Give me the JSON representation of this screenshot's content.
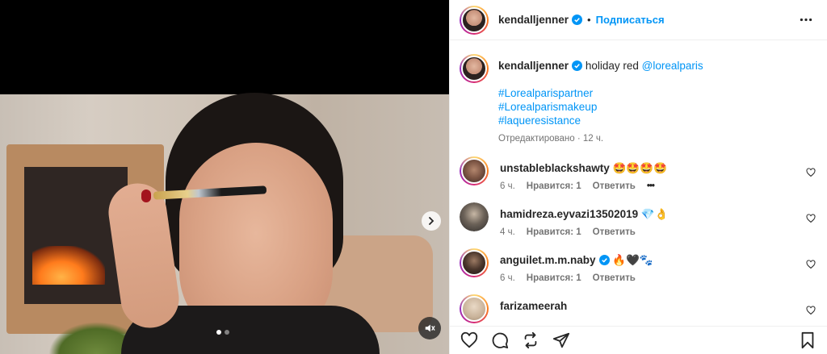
{
  "post": {
    "author": "kendalljenner",
    "separator": "•",
    "follow_label": "Подписаться",
    "caption_text": "holiday red",
    "caption_mention": "@lorealparis",
    "hashtags": [
      "#Lorealparispartner",
      "#Lorealparismakeup",
      "#laqueresistance"
    ],
    "edited_label": "Отредактировано",
    "time": "12 ч."
  },
  "media": {
    "carousel_count": 2,
    "active_index": 0
  },
  "comments": [
    {
      "username": "unstableblackshawty",
      "text": "🤩🤩🤩🤩",
      "time": "6 ч.",
      "likes": "Нравится: 1",
      "reply": "Ответить",
      "more": "•••"
    },
    {
      "username": "hamidreza.eyvazi13502019",
      "text": "💎👌",
      "time": "4 ч.",
      "likes": "Нравится: 1",
      "reply": "Ответить"
    },
    {
      "username": "anguilet.m.m.naby",
      "text": "🔥🖤🐾",
      "time": "6 ч.",
      "likes": "Нравится: 1",
      "reply": "Ответить",
      "verified": true
    },
    {
      "username": "farizameerah",
      "text": ""
    }
  ],
  "icons": {
    "verified": "verified-badge-icon",
    "more": "more-horizontal-icon",
    "next": "chevron-right-icon",
    "mute": "muted-speaker-icon",
    "heart": "heart-outline-icon",
    "comment": "comment-icon",
    "share": "share-icon",
    "save": "bookmark-icon"
  },
  "colors": {
    "accent": "#0095f6",
    "mention": "#00376b",
    "muted_text": "#737373"
  }
}
